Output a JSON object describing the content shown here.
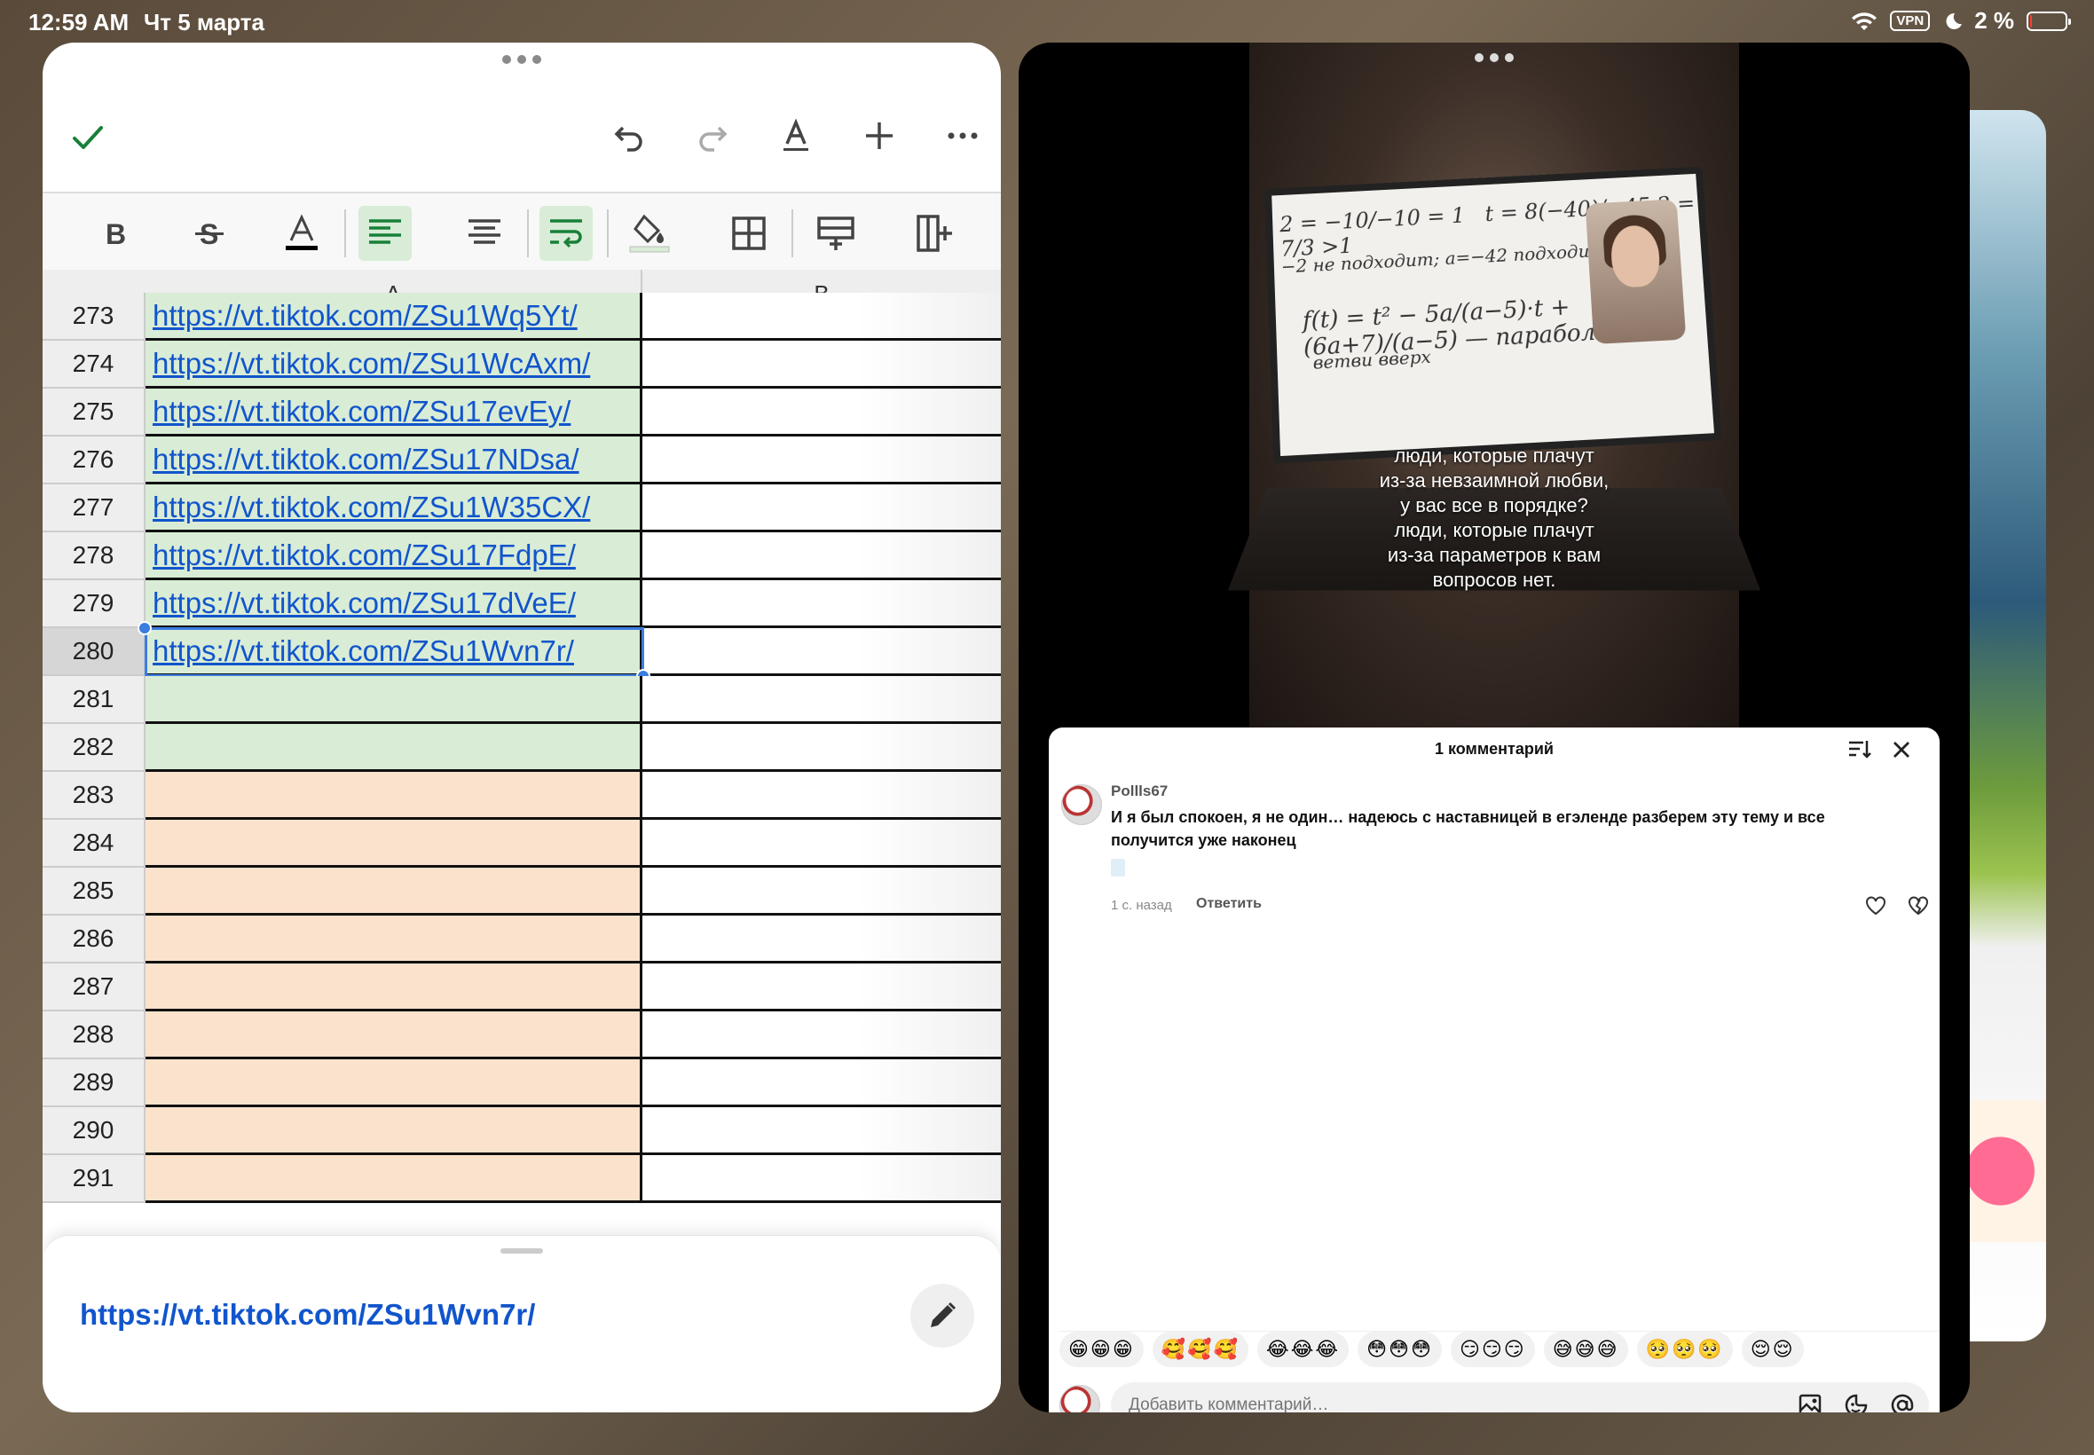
{
  "status_bar": {
    "time": "12:59 AM",
    "date": "Чт 5 марта",
    "vpn": "VPN",
    "battery": "2 %",
    "battery_level": 0.02
  },
  "sheets": {
    "columns": [
      "A",
      "B"
    ],
    "rows": [
      {
        "num": "273",
        "a": "https://vt.tiktok.com/ZSu1Wq5Yt/",
        "fill": "green"
      },
      {
        "num": "274",
        "a": "https://vt.tiktok.com/ZSu1WcAxm/",
        "fill": "green"
      },
      {
        "num": "275",
        "a": "https://vt.tiktok.com/ZSu17evEy/",
        "fill": "green"
      },
      {
        "num": "276",
        "a": "https://vt.tiktok.com/ZSu17NDsa/",
        "fill": "green"
      },
      {
        "num": "277",
        "a": "https://vt.tiktok.com/ZSu1W35CX/",
        "fill": "green"
      },
      {
        "num": "278",
        "a": "https://vt.tiktok.com/ZSu17FdpE/",
        "fill": "green"
      },
      {
        "num": "279",
        "a": "https://vt.tiktok.com/ZSu17dVeE/",
        "fill": "green"
      },
      {
        "num": "280",
        "a": "https://vt.tiktok.com/ZSu1Wvn7r/",
        "fill": "green",
        "selected": true
      },
      {
        "num": "281",
        "a": "",
        "fill": "green"
      },
      {
        "num": "282",
        "a": "",
        "fill": "green"
      },
      {
        "num": "283",
        "a": "",
        "fill": "peach"
      },
      {
        "num": "284",
        "a": "",
        "fill": "peach"
      },
      {
        "num": "285",
        "a": "",
        "fill": "peach"
      },
      {
        "num": "286",
        "a": "",
        "fill": "peach"
      },
      {
        "num": "287",
        "a": "",
        "fill": "peach"
      },
      {
        "num": "288",
        "a": "",
        "fill": "peach"
      },
      {
        "num": "289",
        "a": "",
        "fill": "peach"
      },
      {
        "num": "290",
        "a": "",
        "fill": "peach"
      },
      {
        "num": "291",
        "a": "",
        "fill": "peach"
      }
    ],
    "cell_editor_value": "https://vt.tiktok.com/ZSu1Wvn7r/",
    "colors": {
      "green_fill": "#d9ecd6",
      "peach_fill": "#fbe2cd",
      "link": "#1155cc",
      "accent": "#188038"
    }
  },
  "video": {
    "caption": [
      "люди, которые плачут",
      "из-за невзаимной любви,",
      "у вас все в порядке?",
      "люди, которые плачут",
      "из-за параметров к вам",
      "вопросов нет."
    ]
  },
  "comments": {
    "title": "1 комментарий",
    "items": [
      {
        "user": "Pollls67",
        "text": "И я был спокоен, я не один… надеюсь с наставницей в егэленде разберем эту тему и все получится уже наконец",
        "time": "1 с. назад",
        "reply_label": "Ответить"
      }
    ],
    "emoji_chips": [
      "😁😁😁",
      "🥰🥰🥰",
      "😂😂😂",
      "😳😳😳",
      "😏😏😏",
      "😅😅😅",
      "🥺🥺🥺",
      "😌😌"
    ],
    "input_placeholder": "Добавить комментарий…"
  }
}
